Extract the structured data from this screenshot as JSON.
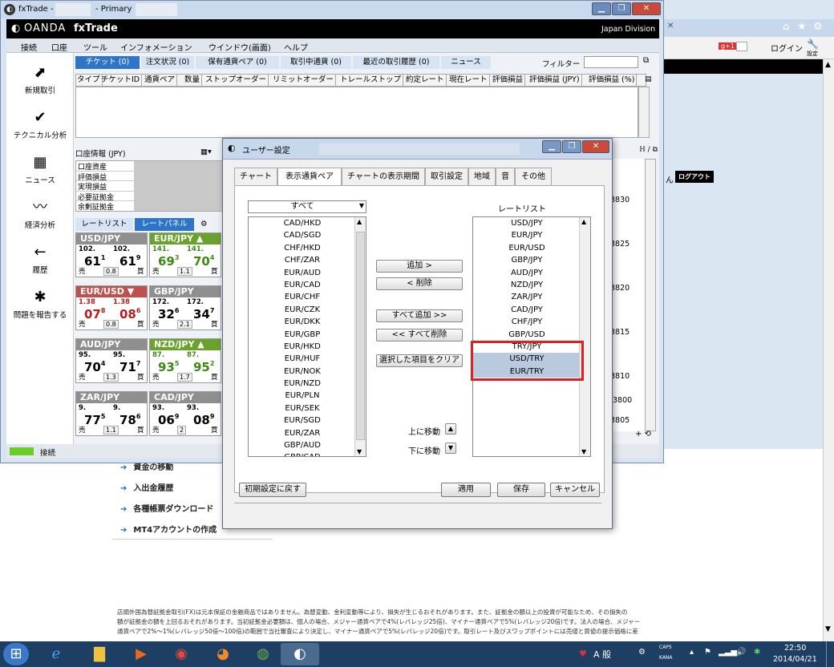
{
  "browser": {
    "login_label": "ログイン",
    "settings_label": "設定",
    "gplus_label": "g+1",
    "logout_label": "ログアウト",
    "partial_text": "ん",
    "web_links": [
      "資金の移動",
      "入出金履歴",
      "各種帳票ダウンロード",
      "MT4アカウントの作成"
    ],
    "footer_lines": [
      "店頭外国為替証拠金取引(FX)は元本保証の金融商品ではありません。為替変動、金利変動等により、損失が生じるおそれがあります。また、証拠金の額以上の投資が可能なため、その損失の",
      "額が証拠金の額を上回るおそれがあります。当初証拠金必要額は、個人の場合、メジャー通貨ペアで4%(レバレッジ25倍)、マイナー通貨ペアで5%(レバレッジ20倍)です。法人の場合、メジャー",
      "通貨ペアで2%～1%(レバレッジ50倍～100倍)の範囲で当社審査により決定し、マイナー通貨ペアで5%(レバレッジ20倍)です。取引レート及びスワップポイントには売値と買値の提示価格に差"
    ]
  },
  "fx": {
    "window_title": "fxTrade -",
    "window_title_suffix": "- Primary",
    "brand": "OANDA",
    "product": "fxTrade",
    "division": "Japan Division",
    "menu": [
      "接続",
      "口座",
      "ツール",
      "インフォメーション",
      "ウインドウ(画面)",
      "ヘルプ"
    ],
    "nav": [
      {
        "label": "新規取引",
        "icon": "⬈"
      },
      {
        "label": "テクニカル分析",
        "icon": "✔"
      },
      {
        "label": "ニュース",
        "icon": "▦"
      },
      {
        "label": "経済分析",
        "icon": "〰"
      },
      {
        "label": "履歴",
        "icon": "←"
      },
      {
        "label": "問題を報告する",
        "icon": "✱"
      }
    ],
    "tabs": [
      "チケット (0)",
      "注文状況 (0)",
      "保有通貨ペア (0)",
      "取引中通貨 (0)",
      "最近の取引履歴 (0)",
      "ニュース"
    ],
    "filter_label": "フィルター",
    "columns": [
      "タイプ",
      "チケットID",
      "通貨ペア",
      "数量",
      "ストップオーダー",
      "リミットオーダー",
      "トレールストップ",
      "約定レート",
      "現在レート",
      "評価損益",
      "評価損益 (JPY)",
      "評価損益 (%)"
    ],
    "account_title": "口座情報 (JPY)",
    "account_rows": [
      "口座資産",
      "評価損益",
      "実現損益",
      "必要証拠金",
      "余剰証拠金"
    ],
    "rate_tabs": [
      "レートリスト",
      "レートパネル"
    ],
    "chart_prices": [
      "3830",
      "3825",
      "3820",
      "3815",
      "3810",
      "3805",
      "3800"
    ],
    "status_label": "接続",
    "tiles": [
      {
        "pair": "USD/JPY",
        "color": "#8f8f8f",
        "arrow": "",
        "sell_small": "102.",
        "sell_big": "61",
        "sell_sup": "1",
        "buy_small": "102.",
        "buy_big": "61",
        "buy_sup": "9",
        "spread": "0.8",
        "big_color": "#000"
      },
      {
        "pair": "EUR/JPY",
        "color": "#6aa22e",
        "arrow": "▲",
        "sell_small": "141.",
        "sell_big": "69",
        "sell_sup": "3",
        "buy_small": "141.",
        "buy_big": "70",
        "buy_sup": "4",
        "spread": "1.1",
        "big_color": "#3c8a12"
      },
      {
        "pair": "EUR/USD",
        "color": "#c0504d",
        "arrow": "▼",
        "sell_small": "1.38",
        "sell_big": "07",
        "sell_sup": "8",
        "buy_small": "1.38",
        "buy_big": "08",
        "buy_sup": "6",
        "spread": "0.8",
        "big_color": "#b02020"
      },
      {
        "pair": "GBP/JPY",
        "color": "#8f8f8f",
        "arrow": "",
        "sell_small": "172.",
        "sell_big": "32",
        "sell_sup": "6",
        "buy_small": "172.",
        "buy_big": "34",
        "buy_sup": "7",
        "spread": "2.1",
        "big_color": "#000"
      },
      {
        "pair": "AUD/JPY",
        "color": "#8f8f8f",
        "arrow": "",
        "sell_small": "95.",
        "sell_big": "70",
        "sell_sup": "4",
        "buy_small": "95.",
        "buy_big": "71",
        "buy_sup": "7",
        "spread": "1.3",
        "big_color": "#000"
      },
      {
        "pair": "NZD/JPY",
        "color": "#6aa22e",
        "arrow": "▲",
        "sell_small": "87.",
        "sell_big": "93",
        "sell_sup": "5",
        "buy_small": "87.",
        "buy_big": "95",
        "buy_sup": "2",
        "spread": "1.7",
        "big_color": "#3c8a12"
      },
      {
        "pair": "ZAR/JPY",
        "color": "#8f8f8f",
        "arrow": "",
        "sell_small": "9.",
        "sell_big": "77",
        "sell_sup": "5",
        "buy_small": "9.",
        "buy_big": "78",
        "buy_sup": "6",
        "spread": "1.1",
        "big_color": "#000"
      },
      {
        "pair": "CAD/JPY",
        "color": "#8f8f8f",
        "arrow": "",
        "sell_small": "93.",
        "sell_big": "06",
        "sell_sup": "9",
        "buy_small": "93.",
        "buy_big": "08",
        "buy_sup": "9",
        "spread": "2",
        "big_color": "#000"
      }
    ],
    "sell_label": "売",
    "buy_label": "買"
  },
  "dialog": {
    "title": "ユーザー設定",
    "tabs": [
      "チャート",
      "表示通貨ペア",
      "チャートの表示期間",
      "取引設定",
      "地域",
      "音",
      "その他"
    ],
    "active_tab": 1,
    "filter_value": "すべて",
    "left_list": [
      "CAD/HKD",
      "CAD/SGD",
      "CHF/HKD",
      "CHF/ZAR",
      "EUR/AUD",
      "EUR/CAD",
      "EUR/CHF",
      "EUR/CZK",
      "EUR/DKK",
      "EUR/GBP",
      "EUR/HKD",
      "EUR/HUF",
      "EUR/NOK",
      "EUR/NZD",
      "EUR/PLN",
      "EUR/SEK",
      "EUR/SGD",
      "EUR/ZAR",
      "GBP/AUD",
      "GBP/CAD"
    ],
    "rate_list_title": "レートリスト",
    "right_list": [
      "USD/JPY",
      "EUR/JPY",
      "EUR/USD",
      "GBP/JPY",
      "AUD/JPY",
      "NZD/JPY",
      "ZAR/JPY",
      "CAD/JPY",
      "CHF/JPY",
      "GBP/USD",
      "TRY/JPY",
      "USD/TRY",
      "EUR/TRY"
    ],
    "selected_items": [
      "USD/TRY",
      "EUR/TRY"
    ],
    "buttons": {
      "add": "追加 >",
      "remove": "< 削除",
      "add_all": "すべて追加 >>",
      "remove_all": "<< すべて削除",
      "clear_selected": "選択した項目をクリア",
      "move_up": "上に移動",
      "move_down": "下に移動",
      "reset": "初期設定に戻す",
      "apply": "適用",
      "save": "保存",
      "cancel": "キャンセル"
    }
  },
  "taskbar": {
    "time": "22:50",
    "date": "2014/04/21",
    "ime": "A 般",
    "caps": "CAPS",
    "kana": "KANA"
  }
}
